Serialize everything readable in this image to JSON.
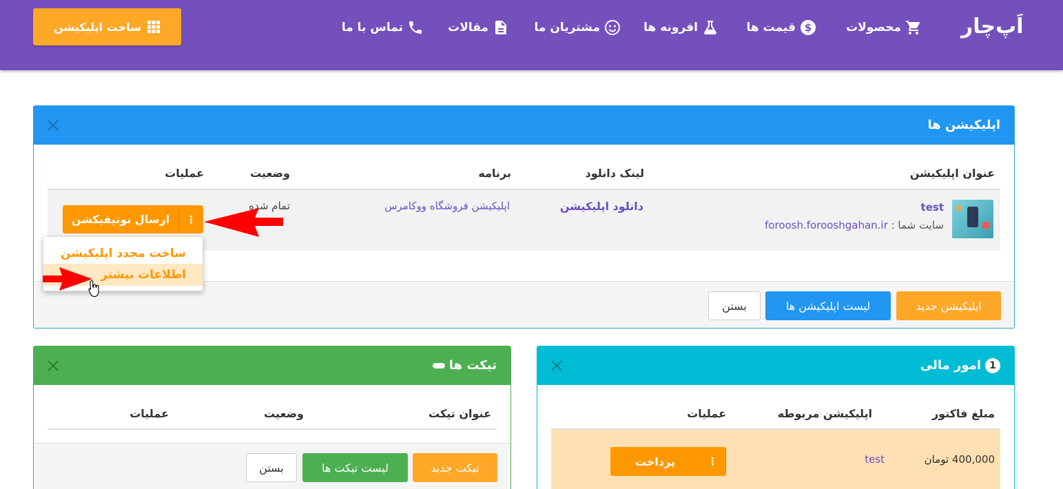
{
  "nav": {
    "logo": "اَپ‌چار",
    "items": [
      {
        "label": "محصولات",
        "icon": "cart-icon"
      },
      {
        "label": "قیمت ها",
        "icon": "dollar-icon"
      },
      {
        "label": "افرونه ها",
        "icon": "flask-icon"
      },
      {
        "label": "مشتریان ما",
        "icon": "smile-icon"
      },
      {
        "label": "مقالات",
        "icon": "document-icon"
      },
      {
        "label": "تماس با ما",
        "icon": "phone-icon"
      }
    ],
    "build_button": "ساخت اپلیکیشن"
  },
  "apps_panel": {
    "title": "اپلیکیشن ها",
    "columns": [
      "عنوان اپلیکیشن",
      "لینک دانلود",
      "برنامه",
      "وضعیت",
      "عملیات"
    ],
    "row": {
      "app_name": "test",
      "site_label": "سایت شما :",
      "site_url": "foroosh.forooshgahan.ir",
      "download_link": "دانلود اپلیکیشن",
      "program": "اپلیکیشن فروشگاه ووکامرس",
      "status": "تمام شده",
      "action_button": "ارسال نوتیفیکشن"
    },
    "dropdown": [
      "ساخت مجدد اپلیکیشن",
      "اطلاعات بیشتر"
    ],
    "footer_buttons": {
      "new": "اپلیکیشن جدید",
      "list": "لیست اپلیکیشن ها",
      "close": "بستن"
    }
  },
  "finance_panel": {
    "title": "امور مالی",
    "badge": "1",
    "columns": [
      "مبلغ فاکتور",
      "اپلیکیشن مربوطه",
      "عملیات"
    ],
    "row": {
      "amount": "400,000 تومان",
      "app": "test",
      "action": "پرداخت"
    }
  },
  "tickets_panel": {
    "title": "تیکت ها",
    "columns": [
      "عنوان تیکت",
      "وضعیت",
      "عملیات"
    ],
    "footer_buttons": {
      "new": "تیکت جدید",
      "list": "لیست تیکت ها",
      "close": "بستن"
    }
  },
  "colors": {
    "navbar": "#7450bd",
    "accent_orange": "#ffa726",
    "apps_header": "#2196f3",
    "finance_header": "#00bcd4",
    "tickets_header": "#4caf50",
    "finance_row": "#ffe0b2",
    "arrow": "#ff0000"
  }
}
